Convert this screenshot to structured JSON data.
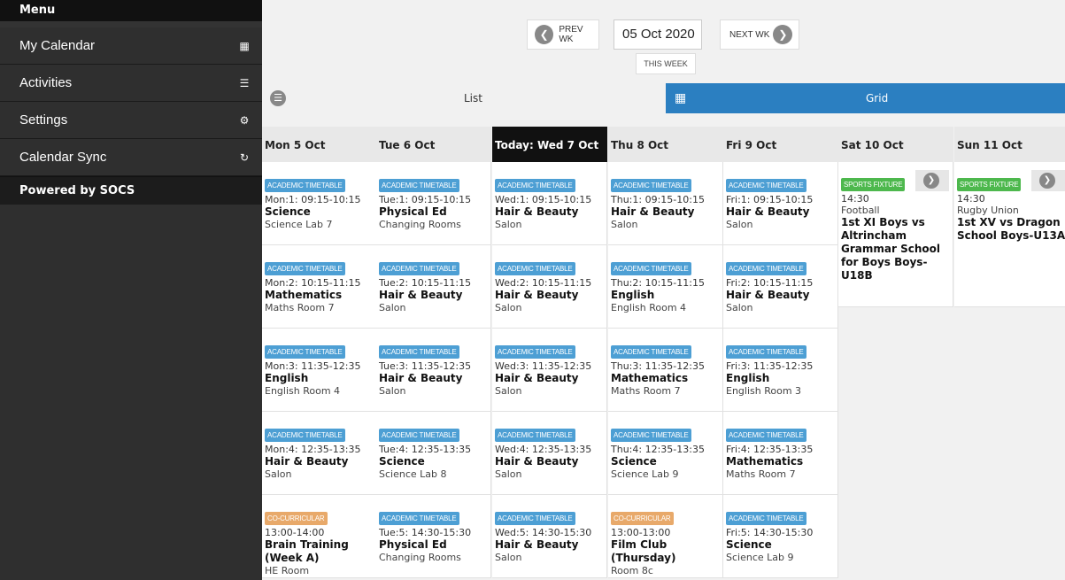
{
  "sidebar": {
    "header": "Menu",
    "items": [
      {
        "label": "My Calendar",
        "icon": "calendar-icon"
      },
      {
        "label": "Activities",
        "icon": "list-icon"
      },
      {
        "label": "Settings",
        "icon": "gear-icon"
      },
      {
        "label": "Calendar Sync",
        "icon": "sync-icon"
      }
    ],
    "footer": "Powered by SOCS"
  },
  "nav": {
    "prev_label": "PREV WK",
    "next_label": "NEXT WK",
    "date_value": "05 Oct 2020",
    "this_week_label": "THIS WEEK"
  },
  "view_tabs": {
    "list_label": "List",
    "grid_label": "Grid"
  },
  "colors": {
    "sidebar_bg": "#2f2f2f",
    "grid_tab": "#2b7fc1",
    "academic_badge": "#4d9fd4",
    "cocurricular_badge": "#e8a96a",
    "sports_badge": "#4db84d"
  },
  "days": [
    {
      "header": "Mon 5 Oct",
      "events": [
        {
          "type": "ACADEMIC TIMETABLE",
          "time": "Mon:1: 09:15-10:15",
          "subject": "Science",
          "room": "Science Lab 7"
        },
        {
          "type": "ACADEMIC TIMETABLE",
          "time": "Mon:2: 10:15-11:15",
          "subject": "Mathematics",
          "room": "Maths Room 7"
        },
        {
          "type": "ACADEMIC TIMETABLE",
          "time": "Mon:3: 11:35-12:35",
          "subject": "English",
          "room": "English Room 4"
        },
        {
          "type": "ACADEMIC TIMETABLE",
          "time": "Mon:4: 12:35-13:35",
          "subject": "Hair & Beauty",
          "room": "Salon"
        },
        {
          "type": "CO-CURRICULAR",
          "time": "13:00-14:00",
          "subject": "Brain Training (Week A)",
          "room": "HE Room"
        }
      ]
    },
    {
      "header": "Tue 6 Oct",
      "events": [
        {
          "type": "ACADEMIC TIMETABLE",
          "time": "Tue:1: 09:15-10:15",
          "subject": "Physical Ed",
          "room": "Changing Rooms"
        },
        {
          "type": "ACADEMIC TIMETABLE",
          "time": "Tue:2: 10:15-11:15",
          "subject": "Hair & Beauty",
          "room": "Salon"
        },
        {
          "type": "ACADEMIC TIMETABLE",
          "time": "Tue:3: 11:35-12:35",
          "subject": "Hair & Beauty",
          "room": "Salon"
        },
        {
          "type": "ACADEMIC TIMETABLE",
          "time": "Tue:4: 12:35-13:35",
          "subject": "Science",
          "room": "Science Lab 8"
        },
        {
          "type": "ACADEMIC TIMETABLE",
          "time": "Tue:5: 14:30-15:30",
          "subject": "Physical Ed",
          "room": "Changing Rooms"
        }
      ]
    },
    {
      "header": "Today: Wed 7 Oct",
      "today": true,
      "events": [
        {
          "type": "ACADEMIC TIMETABLE",
          "time": "Wed:1: 09:15-10:15",
          "subject": "Hair & Beauty",
          "room": "Salon"
        },
        {
          "type": "ACADEMIC TIMETABLE",
          "time": "Wed:2: 10:15-11:15",
          "subject": "Hair & Beauty",
          "room": "Salon"
        },
        {
          "type": "ACADEMIC TIMETABLE",
          "time": "Wed:3: 11:35-12:35",
          "subject": "Hair & Beauty",
          "room": "Salon"
        },
        {
          "type": "ACADEMIC TIMETABLE",
          "time": "Wed:4: 12:35-13:35",
          "subject": "Hair & Beauty",
          "room": "Salon"
        },
        {
          "type": "ACADEMIC TIMETABLE",
          "time": "Wed:5: 14:30-15:30",
          "subject": "Hair & Beauty",
          "room": "Salon"
        }
      ]
    },
    {
      "header": "Thu 8 Oct",
      "events": [
        {
          "type": "ACADEMIC TIMETABLE",
          "time": "Thu:1: 09:15-10:15",
          "subject": "Hair & Beauty",
          "room": "Salon"
        },
        {
          "type": "ACADEMIC TIMETABLE",
          "time": "Thu:2: 10:15-11:15",
          "subject": "English",
          "room": "English Room 4"
        },
        {
          "type": "ACADEMIC TIMETABLE",
          "time": "Thu:3: 11:35-12:35",
          "subject": "Mathematics",
          "room": "Maths Room 7"
        },
        {
          "type": "ACADEMIC TIMETABLE",
          "time": "Thu:4: 12:35-13:35",
          "subject": "Science",
          "room": "Science Lab 9"
        },
        {
          "type": "CO-CURRICULAR",
          "time": "13:00-13:00",
          "subject": "Film Club (Thursday)",
          "room": "Room 8c"
        }
      ]
    },
    {
      "header": "Fri 9 Oct",
      "events": [
        {
          "type": "ACADEMIC TIMETABLE",
          "time": "Fri:1: 09:15-10:15",
          "subject": "Hair & Beauty",
          "room": "Salon"
        },
        {
          "type": "ACADEMIC TIMETABLE",
          "time": "Fri:2: 10:15-11:15",
          "subject": "Hair & Beauty",
          "room": "Salon"
        },
        {
          "type": "ACADEMIC TIMETABLE",
          "time": "Fri:3: 11:35-12:35",
          "subject": "English",
          "room": "English Room 3"
        },
        {
          "type": "ACADEMIC TIMETABLE",
          "time": "Fri:4: 12:35-13:35",
          "subject": "Mathematics",
          "room": "Maths Room 7"
        },
        {
          "type": "ACADEMIC TIMETABLE",
          "time": "Fri:5: 14:30-15:30",
          "subject": "Science",
          "room": "Science Lab 9"
        }
      ]
    },
    {
      "header": "Sat 10 Oct",
      "fixture": {
        "type": "SPORTS FIXTURE",
        "time": "14:30",
        "sport": "Football",
        "title": "1st XI Boys vs Altrincham Grammar School for Boys Boys-U18B"
      }
    },
    {
      "header": "Sun 11 Oct",
      "fixture": {
        "type": "SPORTS FIXTURE",
        "time": "14:30",
        "sport": "Rugby Union",
        "title": "1st XV vs Dragon School Boys-U13A"
      }
    }
  ]
}
